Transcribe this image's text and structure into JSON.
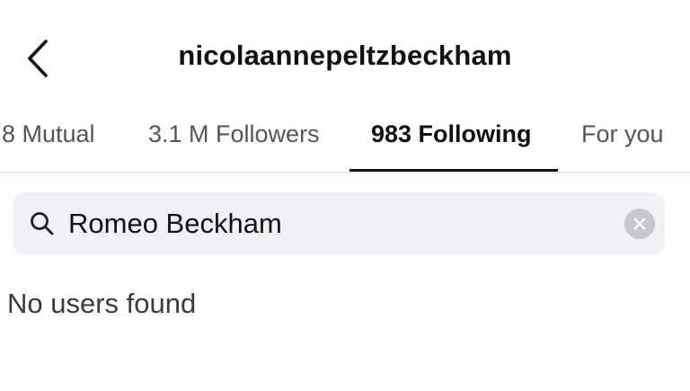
{
  "header": {
    "back_icon": "chevron-left-icon",
    "title": "nicolaannepeltzbeckham"
  },
  "tabs": [
    {
      "label": "8 Mutual",
      "active": false
    },
    {
      "label": "3.1 M Followers",
      "active": false
    },
    {
      "label": "983 Following",
      "active": true
    },
    {
      "label": "For you",
      "active": false
    }
  ],
  "search": {
    "icon": "search-icon",
    "value": "Romeo Beckham",
    "clear_icon": "clear-icon"
  },
  "results": {
    "empty_message": "No users found"
  },
  "colors": {
    "search_background": "#eff1f4",
    "active_underline": "#111111",
    "inactive_tab_text": "#555555"
  }
}
